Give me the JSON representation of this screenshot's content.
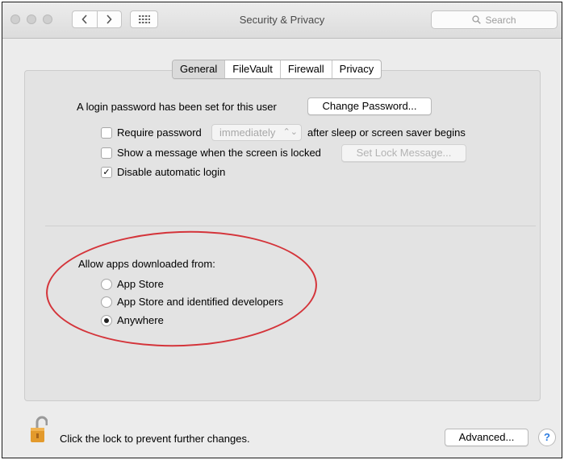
{
  "window": {
    "title": "Security & Privacy",
    "search_placeholder": "Search"
  },
  "tabs": [
    {
      "label": "General",
      "active": true
    },
    {
      "label": "FileVault",
      "active": false
    },
    {
      "label": "Firewall",
      "active": false
    },
    {
      "label": "Privacy",
      "active": false
    }
  ],
  "general": {
    "login_password_text": "A login password has been set for this user",
    "change_password_label": "Change Password...",
    "require_password": {
      "label": "Require password",
      "checked": false
    },
    "require_password_delay": "immediately",
    "require_password_suffix": "after sleep or screen saver begins",
    "show_message": {
      "label": "Show a message when the screen is locked",
      "checked": false
    },
    "set_lock_message_label": "Set Lock Message...",
    "disable_auto_login": {
      "label": "Disable automatic login",
      "checked": true
    }
  },
  "allow_apps": {
    "heading": "Allow apps downloaded from:",
    "options": [
      {
        "label": "App Store",
        "selected": false
      },
      {
        "label": "App Store and identified developers",
        "selected": false
      },
      {
        "label": "Anywhere",
        "selected": true
      }
    ]
  },
  "footer": {
    "lock_text": "Click the lock to prevent further changes.",
    "advanced_label": "Advanced...",
    "help_label": "?"
  },
  "colors": {
    "annotation_ellipse": "#d4343a",
    "lock_body": "#e39a2c",
    "help_accent": "#2b7be0"
  },
  "icons": [
    "close-button-icon",
    "minimize-button-icon",
    "zoom-button-icon",
    "chevron-left-icon",
    "chevron-right-icon",
    "grid-icon",
    "search-icon",
    "checkmark-icon",
    "updown-arrows-icon",
    "unlocked-padlock-icon"
  ]
}
